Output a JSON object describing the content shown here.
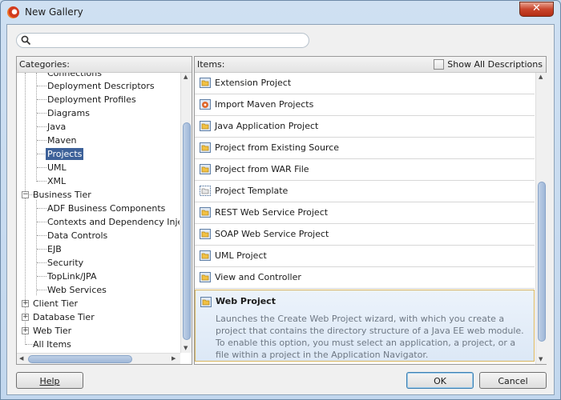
{
  "window": {
    "title": "New Gallery",
    "close_glyph": "✕"
  },
  "search": {
    "value": "",
    "placeholder": "",
    "icon": "search-icon"
  },
  "categories": {
    "header": "Categories:",
    "items": [
      {
        "label": "Connections",
        "kind": "leaf"
      },
      {
        "label": "Deployment Descriptors",
        "kind": "leaf"
      },
      {
        "label": "Deployment Profiles",
        "kind": "leaf"
      },
      {
        "label": "Diagrams",
        "kind": "leaf"
      },
      {
        "label": "Java",
        "kind": "leaf"
      },
      {
        "label": "Maven",
        "kind": "leaf"
      },
      {
        "label": "Projects",
        "kind": "leaf",
        "selected": true
      },
      {
        "label": "UML",
        "kind": "leaf"
      },
      {
        "label": "XML",
        "kind": "leaf"
      },
      {
        "label": "Business Tier",
        "kind": "group",
        "expanded": true
      },
      {
        "label": "ADF Business Components",
        "kind": "leaf"
      },
      {
        "label": "Contexts and Dependency Injection",
        "kind": "leaf"
      },
      {
        "label": "Data Controls",
        "kind": "leaf"
      },
      {
        "label": "EJB",
        "kind": "leaf"
      },
      {
        "label": "Security",
        "kind": "leaf"
      },
      {
        "label": "TopLink/JPA",
        "kind": "leaf"
      },
      {
        "label": "Web Services",
        "kind": "leaf"
      },
      {
        "label": "Client Tier",
        "kind": "group",
        "expanded": false
      },
      {
        "label": "Database Tier",
        "kind": "group",
        "expanded": false
      },
      {
        "label": "Web Tier",
        "kind": "group",
        "expanded": false
      },
      {
        "label": "All Items",
        "kind": "root"
      }
    ]
  },
  "items_panel": {
    "header": "Items:",
    "show_all_descriptions": {
      "label": "Show All Descriptions",
      "checked": false
    },
    "items": [
      {
        "label": "Extension Project",
        "icon": "project-folder-icon"
      },
      {
        "label": "Import Maven Projects",
        "icon": "maven-icon"
      },
      {
        "label": "Java Application Project",
        "icon": "project-folder-icon"
      },
      {
        "label": "Project from Existing Source",
        "icon": "project-folder-icon"
      },
      {
        "label": "Project from WAR File",
        "icon": "project-folder-icon"
      },
      {
        "label": "Project Template",
        "icon": "project-template-icon"
      },
      {
        "label": "REST Web Service Project",
        "icon": "project-folder-icon"
      },
      {
        "label": "SOAP Web Service Project",
        "icon": "project-folder-icon"
      },
      {
        "label": "UML Project",
        "icon": "project-folder-icon"
      },
      {
        "label": "View and Controller",
        "icon": "project-folder-icon"
      },
      {
        "label": "Web Project",
        "icon": "project-folder-icon",
        "selected": true,
        "description": "Launches the Create Web Project wizard, with which you create a project that contains the directory structure of a Java EE web module. To enable this option, you must select an application, a project, or a file within a project in the Application Navigator."
      }
    ]
  },
  "buttons": {
    "help": "Help",
    "ok": "OK",
    "cancel": "Cancel"
  },
  "colors": {
    "selection": "#3d6199",
    "selected_item_border": "#d8b45c",
    "close_red": "#c9452c"
  }
}
